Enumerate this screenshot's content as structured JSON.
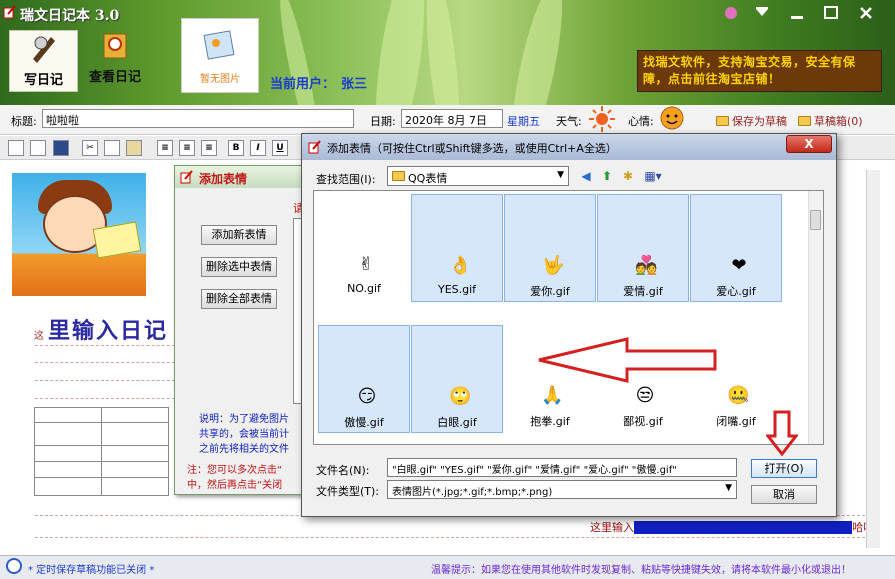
{
  "app": {
    "title": "瑞文日记本 3.0",
    "write_diary": "写日记",
    "view_diary": "查看日记",
    "no_image": "暂无图片",
    "current_user_label": "当前用户：",
    "current_user_name": "张三",
    "promo": "找瑞文软件，支持淘宝交易，安全有保障，点击前往淘宝店铺！"
  },
  "title_row": {
    "title_label": "标题:",
    "title_value": "啦啦啦",
    "date_label": "日期:",
    "date_value": "2020年 8月 7日",
    "weekday": "星期五",
    "weather_label": "天气:",
    "mood_label": "心情:",
    "save_draft": "保存为草稿",
    "draft_box": "草稿箱(0)"
  },
  "toolbar": {
    "bold": "B",
    "italic": "I",
    "underline": "U"
  },
  "editor": {
    "hint_large": "里输入日记",
    "hint_small": "这",
    "bottom_hint": "这里输入",
    "bottom_hint_tail": "哈哈"
  },
  "emoticon_dialog": {
    "title": "添加表情",
    "add_button": "添加新表情",
    "delete_selected_button": "删除选中表情",
    "delete_all_button": "删除全部表情",
    "note_lines": [
      "说明：为了避免图片",
      "共享的，会被当前计",
      "之前先将相关的文件"
    ],
    "warning_lines": [
      "注：您可以多次点击“",
      "中，然后再点击“关闭"
    ],
    "red_char": "请"
  },
  "file_dialog": {
    "title": "添加表情（可按住Ctrl或Shift键多选，或使用Ctrl+A全选）",
    "look_in_label": "查找范围(I):",
    "look_in_value": "QQ表情",
    "file_name_label": "文件名(N):",
    "file_name_value": "\"白眼.gif\" \"YES.gif\" \"爱你.gif\" \"爱情.gif\" \"爱心.gif\" \"傲慢.gif\"",
    "file_type_label": "文件类型(T):",
    "file_type_value": "表情图片(*.jpg;*.gif;*.bmp;*.png)",
    "open_button": "打开(O)",
    "cancel_button": "取消",
    "close_symbol": "X",
    "files": [
      {
        "name": "NO.gif",
        "icon": "✌",
        "selected": false
      },
      {
        "name": "YES.gif",
        "icon": "👌",
        "selected": true
      },
      {
        "name": "爱你.gif",
        "icon": "🤟",
        "selected": true
      },
      {
        "name": "爱情.gif",
        "icon": "💑",
        "selected": true
      },
      {
        "name": "爱心.gif",
        "icon": "❤",
        "selected": true
      },
      {
        "name": "傲慢.gif",
        "icon": "😏",
        "selected": true
      },
      {
        "name": "白眼.gif",
        "icon": "🙄",
        "selected": true
      },
      {
        "name": "抱拳.gif",
        "icon": "🙏",
        "selected": false
      },
      {
        "name": "鄙视.gif",
        "icon": "😒",
        "selected": false
      },
      {
        "name": "闭嘴.gif",
        "icon": "🤐",
        "selected": false
      }
    ]
  },
  "status_bar": {
    "autosave": "* 定时保存草稿功能已关闭 *",
    "tip": "温馨提示：如果您在使用其他软件时发现复制、粘贴等快捷键失效，请将本软件最小化或退出！"
  },
  "colors": {
    "accent_blue": "#1a3bd0",
    "promo_bg": "#6b3a08",
    "promo_text": "#ffd200",
    "selection": "#d6e7fb",
    "arrow_red": "#d42020"
  }
}
